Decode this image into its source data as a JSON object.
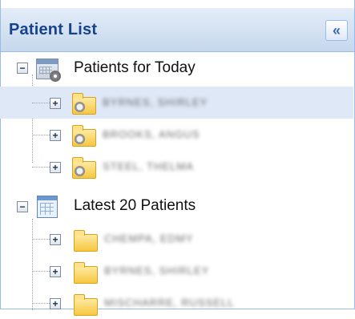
{
  "panel": {
    "title": "Patient List",
    "collapse_glyph": "«"
  },
  "tree": {
    "groups": [
      {
        "label": "Patients for Today",
        "expander": "−",
        "icon": "schedule-icon",
        "items": [
          {
            "expander": "+",
            "icon": "folder-clock-icon",
            "name": "BYRNES, SHIRLEY",
            "selected": true
          },
          {
            "expander": "+",
            "icon": "folder-clock-icon",
            "name": "BROOKS, ANGUS",
            "selected": false
          },
          {
            "expander": "+",
            "icon": "folder-clock-icon",
            "name": "STEEL, THELMA",
            "selected": false
          }
        ]
      },
      {
        "label": "Latest 20 Patients",
        "expander": "−",
        "icon": "grid-icon",
        "items": [
          {
            "expander": "+",
            "icon": "folder-icon",
            "name": "CHEMPA, EDMY"
          },
          {
            "expander": "+",
            "icon": "folder-icon",
            "name": "BYRNES, SHIRLEY"
          },
          {
            "expander": "+",
            "icon": "folder-icon",
            "name": "MISCHARRE, RUSSELL"
          }
        ]
      }
    ]
  }
}
